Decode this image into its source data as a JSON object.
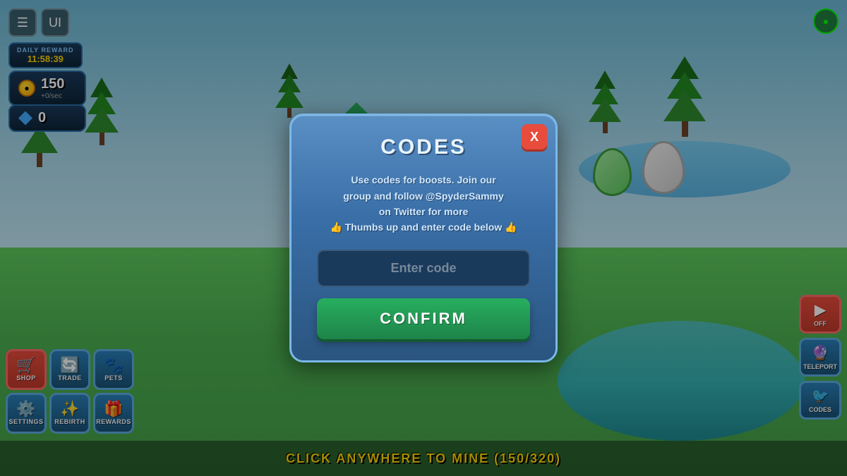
{
  "topLeft": {
    "icon1": "☰",
    "icon2": "UI"
  },
  "topRight": {
    "icon": "●"
  },
  "dailyReward": {
    "label": "DAILY REWARD",
    "timer": "11:58:39"
  },
  "coins": {
    "amount": "150",
    "rate": "+0/sec"
  },
  "gems": {
    "amount": "0"
  },
  "buttons": [
    {
      "id": "shop",
      "label": "SHOP",
      "icon": "🛒"
    },
    {
      "id": "trade",
      "label": "TRADE",
      "icon": "🔄"
    },
    {
      "id": "pets",
      "label": "PETS",
      "icon": "🐾"
    },
    {
      "id": "settings",
      "label": "SETTINGS",
      "icon": "⚙️"
    },
    {
      "id": "rebirth",
      "label": "REBIRTH",
      "icon": "✨"
    },
    {
      "id": "rewards",
      "label": "REWARDS",
      "icon": "🎁"
    }
  ],
  "rightButtons": [
    {
      "id": "off",
      "label": "OFF",
      "icon": "▶"
    },
    {
      "id": "teleport",
      "label": "TELEPORT",
      "icon": "🔮"
    },
    {
      "id": "codes",
      "label": "CODES",
      "icon": "🐦"
    }
  ],
  "bottomBar": {
    "text": "CLICK ANYWHERE TO MINE (150/320)"
  },
  "modal": {
    "title": "CODES",
    "closeLabel": "X",
    "description1": "Use codes for boosts. Join our",
    "description2": "group and follow @SpyderSammy",
    "description3": "on Twitter for more",
    "description4": "👍 Thumbs up and enter code below 👍",
    "inputPlaceholder": "Enter code",
    "confirmLabel": "CONFIRM"
  }
}
